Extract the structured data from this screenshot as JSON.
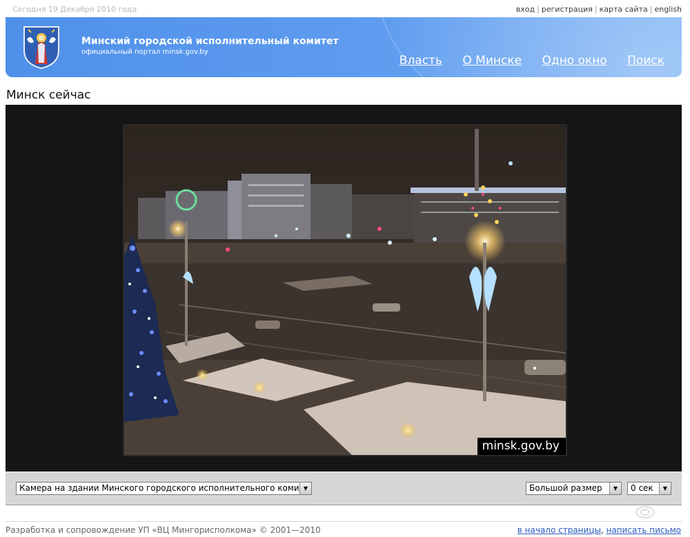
{
  "top": {
    "date": "Сегодня 19 Декабря 2010 года",
    "links": [
      "вход",
      "регистрация",
      "карта сайта",
      "english"
    ]
  },
  "header": {
    "title": "Минский городской исполнительный комитет",
    "subtitle": "официальный портал minsk.gov.by",
    "nav": [
      "Власть",
      "О Минске",
      "Одно окно",
      "Поиск"
    ],
    "logo_icon": "minsk-coat-of-arms-icon"
  },
  "page": {
    "title": "Минск сейчас"
  },
  "camera": {
    "watermark": "minsk.gov.by"
  },
  "controls": {
    "camera_select": "Камера на здании Минского городского исполнительного комитета",
    "size_select": "Большой размер",
    "refresh_select": "0 сек"
  },
  "footer": {
    "copyright": "Разработка и сопровождение УП «ВЦ Мингорисполкома» © 2001—2010",
    "links": [
      "в начало страницы",
      "написать письмо"
    ]
  },
  "colors": {
    "header_blue": "#5f9cef",
    "link_blue": "#2a5bbf"
  }
}
